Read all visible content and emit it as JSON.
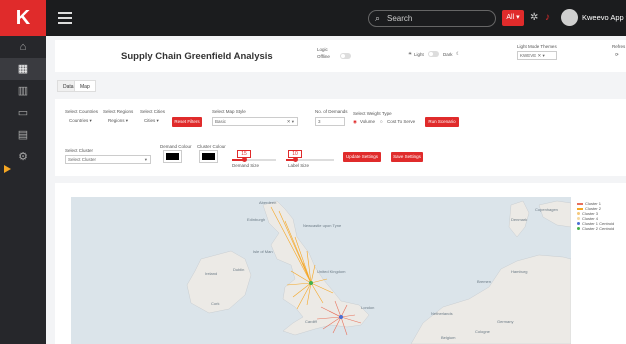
{
  "topbar": {
    "logo": "K",
    "search_placeholder": "Search",
    "all_badge": "All",
    "app_name": "Kweevo App"
  },
  "page": {
    "title": "Supply Chain Greenfield Analysis",
    "logic_label": "Logic",
    "logic_value": "Offline",
    "light_label": "Light",
    "dark_label": "Dark",
    "light_mode_themes_label": "Light Mode Themes",
    "light_mode_themes_value": "KWEVE",
    "refresh_label": "Refres"
  },
  "tabs": [
    {
      "label": "Data"
    },
    {
      "label": "Map"
    }
  ],
  "filters": {
    "countries_label": "Select Countries",
    "countries_value": "Countries",
    "regions_label": "Select Regions",
    "regions_value": "Regions",
    "cities_label": "Select Cities",
    "cities_value": "Cities",
    "reset_filters": "Reset Filters",
    "map_style_label": "Select Map Style",
    "map_style_value": "Basic",
    "demands_label": "No. of Demands",
    "demands_value": "3",
    "weight_type_label": "Select Weight Type",
    "weight_volume": "Volume",
    "weight_cost": "Cost To Serve",
    "run_scenario": "Run Scenario",
    "cluster_label": "Select Cluster",
    "cluster_placeholder": "Select Cluster",
    "demand_colour_label": "Demand Colour",
    "cluster_colour_label": "Cluster Colour",
    "demand_size_label": "Demand Size",
    "demand_size_value": "15",
    "label_size_label": "Label Size",
    "label_size_value": "10",
    "update_settings": "Update Settings",
    "save_settings": "Save Settings"
  },
  "legend": [
    {
      "name": "Cluster 1",
      "color": "#e8705a"
    },
    {
      "name": "Cluster 2",
      "color": "#f5a623"
    },
    {
      "name": "Cluster 3",
      "color": "#f5c97a"
    },
    {
      "name": "Cluster 4",
      "color": "#f5d9a0"
    },
    {
      "name": "Cluster 1 Centroid",
      "color": "#4a6fd4"
    },
    {
      "name": "Cluster 2 Centroid",
      "color": "#44b04a"
    }
  ],
  "map_labels": {
    "aberdeen": "Aberdeen",
    "edinburgh": "Edinburgh",
    "newcastle": "Newcastle upon Tyne",
    "isle_of_man": "Isle of Man",
    "ireland": "Ireland",
    "dublin": "Dublin",
    "united_kingdom": "United Kingdom",
    "netherlands": "Netherlands",
    "london": "London",
    "cardiff": "Cardiff",
    "cork": "Cork",
    "germany": "Germany",
    "hamburg": "Hamburg",
    "copenhagen": "Copenhagen",
    "denmark": "Denmark",
    "bremen": "Bremen",
    "belgium": "Belgium",
    "cologne": "Cologne"
  },
  "colors": {
    "accent": "#e02b2b",
    "sidebar": "#26272b",
    "topbar": "#1b1c1e",
    "sea": "#dbe4ea",
    "land": "#eceae6"
  }
}
